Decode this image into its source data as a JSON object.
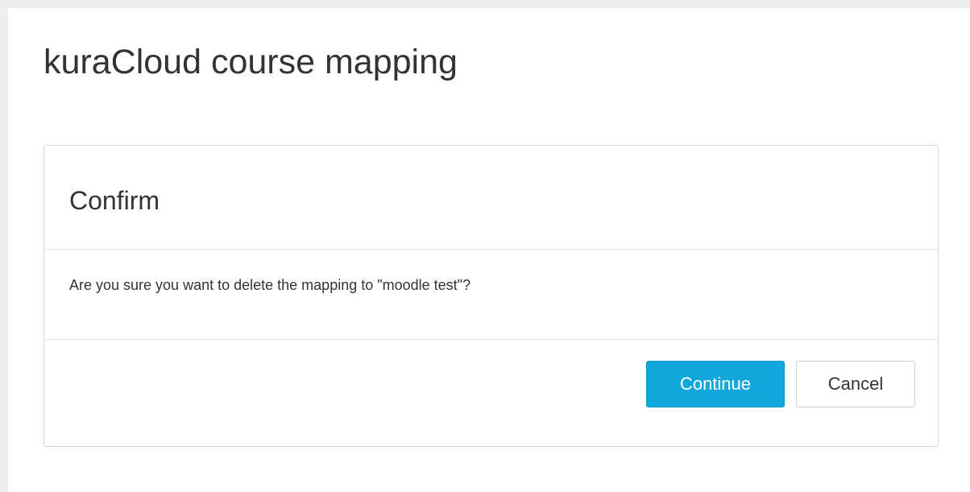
{
  "page": {
    "title": "kuraCloud course mapping"
  },
  "dialog": {
    "title": "Confirm",
    "message": "Are you sure you want to delete the mapping to \"moodle test\"?",
    "buttons": {
      "continue_label": "Continue",
      "cancel_label": "Cancel"
    }
  },
  "colors": {
    "page_background": "#eeeeee",
    "surface": "#ffffff",
    "primary_button": "#11a7dd",
    "text": "#333333",
    "border": "#d7d7d7"
  }
}
